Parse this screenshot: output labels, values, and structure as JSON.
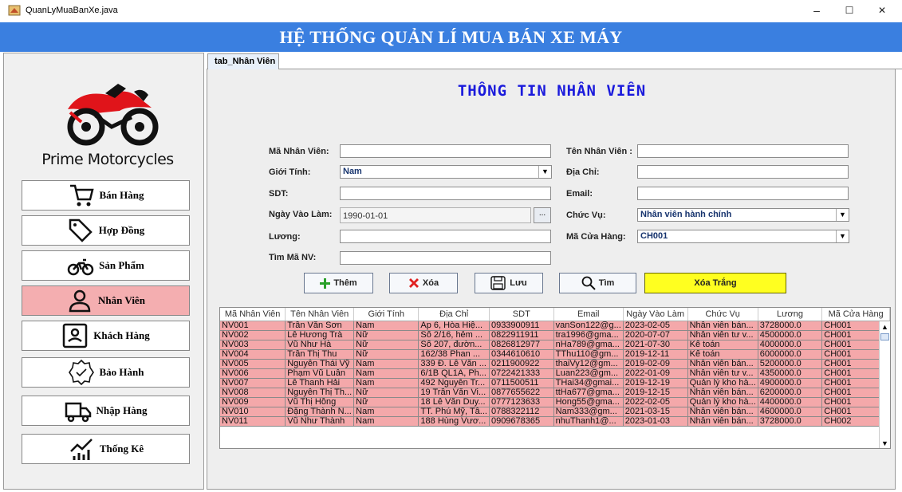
{
  "window": {
    "title": "QuanLyMuaBanXe.java",
    "min": "–",
    "max": "☐",
    "close": "✕"
  },
  "header": {
    "title": "HỆ THỐNG QUẢN LÍ MUA BÁN XE MÁY",
    "bg": "#3a7fe0"
  },
  "sidebar": {
    "brand": "Prime Motorcycles",
    "items": [
      {
        "label": "Bán Hàng",
        "icon": "cart-icon"
      },
      {
        "label": "Hợp Đồng",
        "icon": "tag-icon"
      },
      {
        "label": "Sản Phẩm",
        "icon": "motorbike-icon"
      },
      {
        "label": "Nhân Viên",
        "icon": "user-icon",
        "active": true
      },
      {
        "label": "Khách Hàng",
        "icon": "id-card-icon"
      },
      {
        "label": "Bảo Hành",
        "icon": "warranty-badge-icon"
      },
      {
        "label": "Nhập Hàng",
        "icon": "truck-icon"
      },
      {
        "label": "Thống Kê",
        "icon": "chart-icon"
      }
    ]
  },
  "tab": {
    "label": "tab_Nhân Viên"
  },
  "form": {
    "title": "THÔNG TIN NHÂN VIÊN",
    "ma_nv": {
      "label": "Mã Nhân Viên:",
      "value": ""
    },
    "ten_nv": {
      "label": "Tên Nhân Viên :",
      "value": ""
    },
    "gioi_tinh": {
      "label": "Giới Tính:",
      "value": "Nam"
    },
    "dia_chi": {
      "label": "Địa Chỉ:",
      "value": ""
    },
    "sdt": {
      "label": "SDT:",
      "value": ""
    },
    "email": {
      "label": "Email:",
      "value": ""
    },
    "ngay_vao_lam": {
      "label": "Ngày Vào Làm:",
      "value": "1990-01-01",
      "btn": "..."
    },
    "chuc_vu": {
      "label": "Chức Vụ:",
      "value": "Nhân viên hành chính"
    },
    "luong": {
      "label": "Lương:",
      "value": ""
    },
    "ma_cua_hang": {
      "label": "Mã Cửa Hàng:",
      "value": "CH001"
    },
    "tim_ma_nv": {
      "label": "Tìm Mã NV:",
      "value": ""
    }
  },
  "buttons": {
    "them": "Thêm",
    "xoa": "Xóa",
    "luu": "Lưu",
    "tim": "Tìm",
    "xoa_trang": "Xóa Trắng"
  },
  "table": {
    "headers": [
      "Mã Nhân Viên",
      "Tên Nhân Viên",
      "Giới Tính",
      "Địa Chỉ",
      "SDT",
      "Email",
      "Ngày Vào Làm",
      "Chức Vụ",
      "Lương",
      "Mã Cửa Hàng"
    ],
    "rows": [
      [
        "NV001",
        "Trần Văn Sơn",
        "Nam",
        "Ấp 6, Hòa Hiệ...",
        "0933900911",
        "vanSon122@g...",
        "2023-02-05",
        "Nhân viên bán...",
        "3728000.0",
        "CH001"
      ],
      [
        "NV002",
        "Lê Hương Trà",
        "Nữ",
        "Số 2/16, hẻm ...",
        "0822911911",
        "tra1996@gma...",
        "2020-07-07",
        "Nhân viên tư v...",
        "4500000.0",
        "CH001"
      ],
      [
        "NV003",
        "Vũ Như Hà",
        "Nữ",
        "Số 207, đườn...",
        "0826812977",
        "nHa789@gma...",
        "2021-07-30",
        "Kế toán",
        "4000000.0",
        "CH001"
      ],
      [
        "NV004",
        "Trần Thị Thu",
        "Nữ",
        "162/38 Phan ...",
        "0344610610",
        "TThu110@gm...",
        "2019-12-11",
        "Kế toán",
        "6000000.0",
        "CH001"
      ],
      [
        "NV005",
        "Nguyễn Thái Vỹ",
        "Nam",
        "339 Đ. Lê Văn ...",
        "0211900922",
        "thaiVy12@gm...",
        "2019-02-09",
        "Nhân viên bán...",
        "5200000.0",
        "CH001"
      ],
      [
        "NV006",
        "Phạm Vũ Luân",
        "Nam",
        "6/1B QL1A, Ph...",
        "0722421333",
        "Luan223@gm...",
        "2022-01-09",
        "Nhân viên tư v...",
        "4350000.0",
        "CH001"
      ],
      [
        "NV007",
        "Lê Thanh Hải",
        "Nam",
        "492 Nguyễn Tr...",
        "0711500511",
        "THai34@gmai...",
        "2019-12-19",
        "Quản lý kho hà...",
        "4900000.0",
        "CH001"
      ],
      [
        "NV008",
        "Nguyễn Thị Th...",
        "Nữ",
        "19 Trần Văn Vi...",
        "0877655622",
        "ttHa677@gma...",
        "2019-12-15",
        "Nhân viên bán...",
        "6200000.0",
        "CH001"
      ],
      [
        "NV009",
        "Vũ Thị Hồng",
        "Nữ",
        "18 Lê Văn Duy...",
        "0777123633",
        "Hong55@gma...",
        "2022-02-05",
        "Quản lý kho hà...",
        "4400000.0",
        "CH001"
      ],
      [
        "NV010",
        "Đặng Thành N...",
        "Nam",
        "TT. Phú Mỹ, Tâ...",
        "0788322112",
        "Nam333@gm...",
        "2021-03-15",
        "Nhân viên bán...",
        "4600000.0",
        "CH001"
      ],
      [
        "NV011",
        "Vũ Như Thành",
        "Nam",
        "188 Hùng Vươ...",
        "0909678365",
        "nhuThanh1@...",
        "2023-01-03",
        "Nhân viên bán...",
        "3728000.0",
        "CH002"
      ]
    ]
  }
}
